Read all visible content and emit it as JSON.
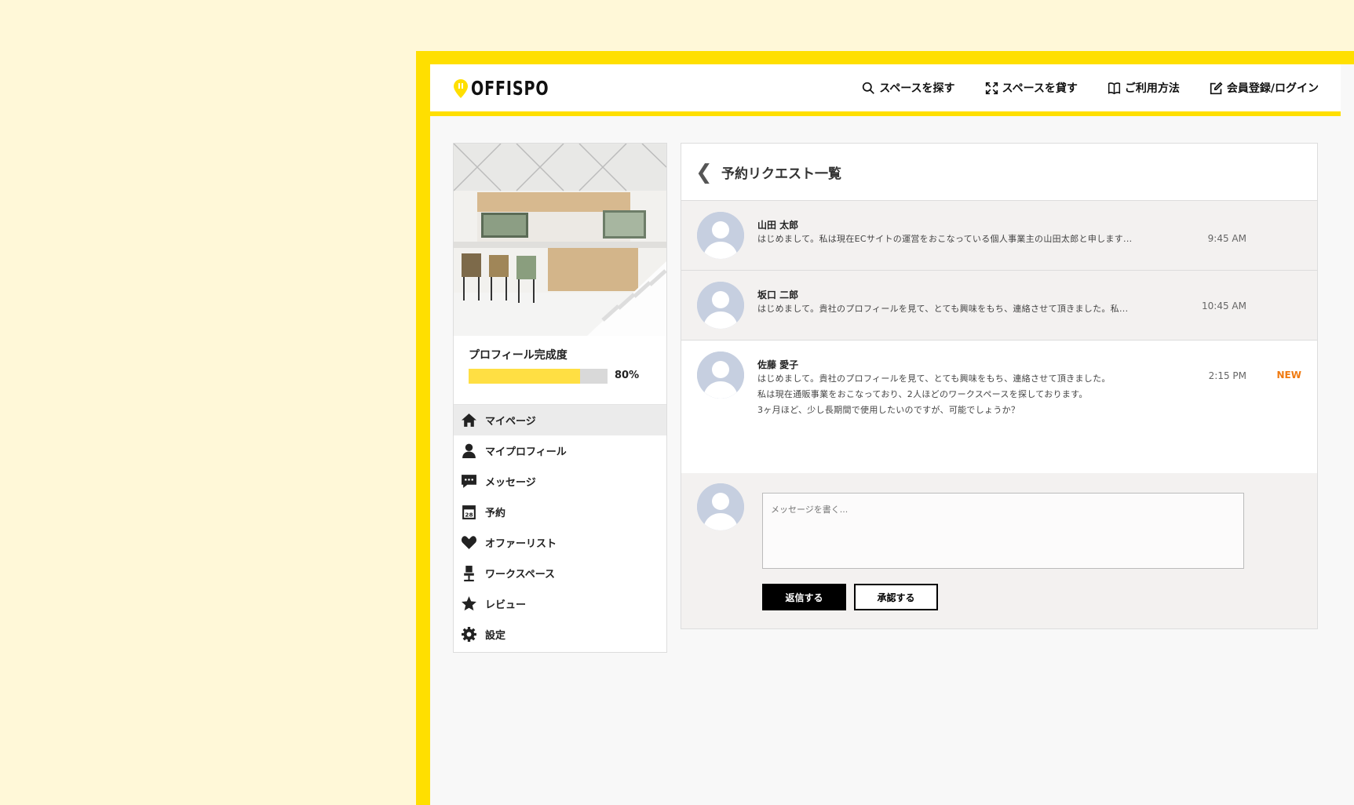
{
  "colors": {
    "brand": "#ffdf00",
    "new_badge": "#f07a10",
    "progress_fill": "#ffdf43"
  },
  "header": {
    "logo_text": "OFFISPO",
    "nav": [
      {
        "label": "スペースを探す",
        "icon": "search-icon"
      },
      {
        "label": "スペースを貸す",
        "icon": "expand-icon"
      },
      {
        "label": "ご利用方法",
        "icon": "book-icon"
      },
      {
        "label": "会員登録/ログイン",
        "icon": "edit-icon"
      }
    ]
  },
  "sidebar": {
    "progress_label": "プロフィール完成度",
    "progress_value": 0.8,
    "progress_text": "80%",
    "items": [
      {
        "label": "マイページ",
        "icon": "home-icon",
        "active": true
      },
      {
        "label": "マイプロフィール",
        "icon": "user-icon"
      },
      {
        "label": "メッセージ",
        "icon": "chat-icon"
      },
      {
        "label": "予約",
        "icon": "calendar-icon"
      },
      {
        "label": "オファーリスト",
        "icon": "heart-icon"
      },
      {
        "label": "ワークスペース",
        "icon": "office-chair-icon"
      },
      {
        "label": "レビュー",
        "icon": "star-icon"
      },
      {
        "label": "設定",
        "icon": "gear-icon"
      }
    ]
  },
  "main": {
    "back_icon": "❮",
    "title": "予約リクエスト一覧",
    "requests": [
      {
        "name": "山田 太郎",
        "message": [
          "はじめまして。私は現在ECサイトの運営をおこなっている個人事業主の山田太郎と申します..."
        ],
        "time": "9:45 AM",
        "read": true
      },
      {
        "name": "坂口 二郎",
        "message": [
          "はじめまして。貴社のプロフィールを見て、とても興味をもち、連絡させて頂きました。私..."
        ],
        "time": "10:45 AM",
        "read": true
      },
      {
        "name": "佐藤 愛子",
        "message": [
          "はじめまして。貴社のプロフィールを見て、とても興味をもち、連絡させて頂きました。",
          "私は現在通販事業をおこなっており、2人ほどのワークスペースを探しております。",
          "3ヶ月ほど、少し長期間で使用したいのですが、可能でしょうか？"
        ],
        "time": "2:15 PM",
        "read": false,
        "badge": "NEW"
      }
    ],
    "reply": {
      "placeholder": "メッセージを書く...",
      "send_label": "返信する",
      "approve_label": "承認する"
    }
  }
}
